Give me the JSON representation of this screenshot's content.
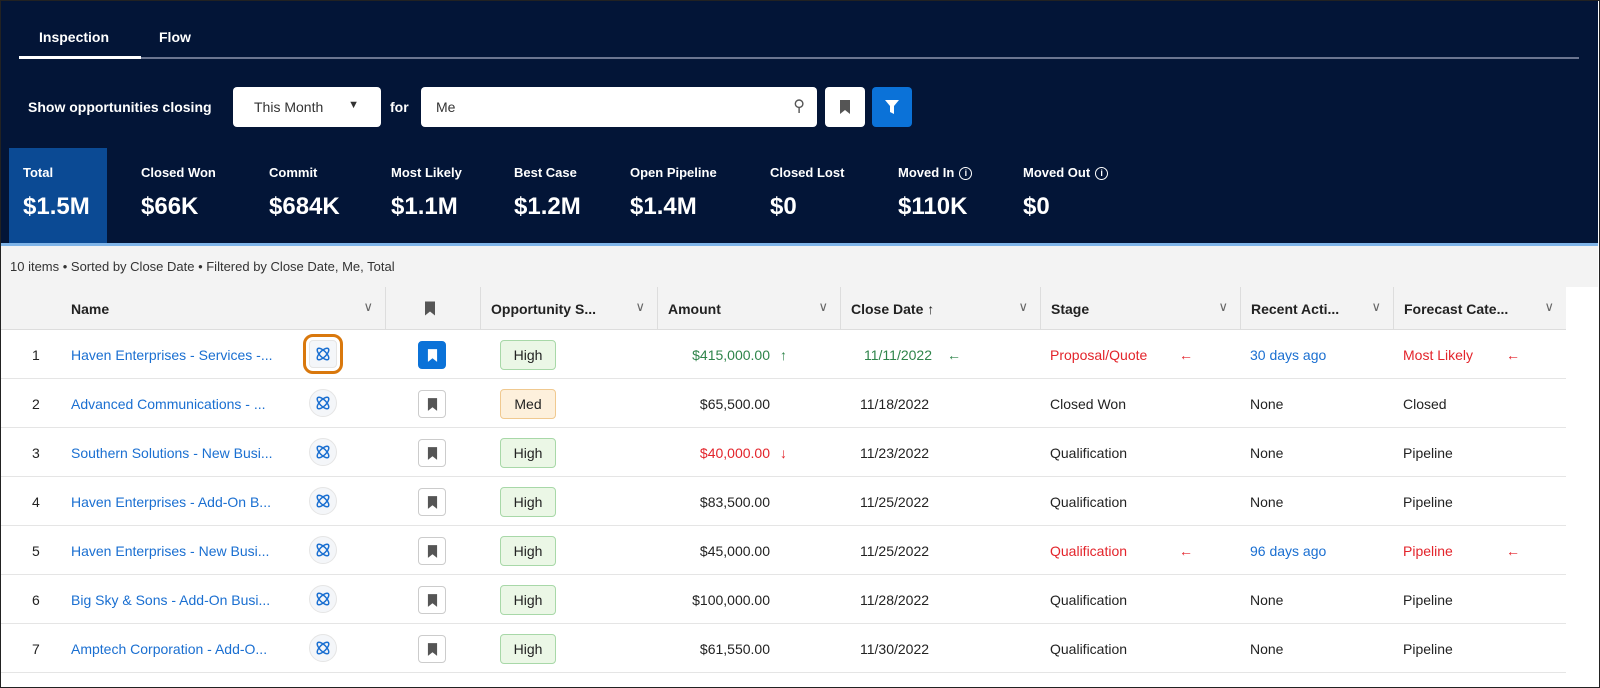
{
  "tabs": [
    {
      "label": "Inspection",
      "active": true
    },
    {
      "label": "Flow",
      "active": false
    }
  ],
  "filter": {
    "label": "Show opportunities closing",
    "period": "This Month",
    "for_label": "for",
    "owner": "Me",
    "search_icon": "search-icon",
    "bookmark_icon": "bookmark-icon",
    "filter_icon": "filter-icon"
  },
  "metrics": [
    {
      "label": "Total",
      "value": "$1.5M",
      "active": true
    },
    {
      "label": "Closed Won",
      "value": "$66K"
    },
    {
      "label": "Commit",
      "value": "$684K"
    },
    {
      "label": "Most Likely",
      "value": "$1.1M"
    },
    {
      "label": "Best Case",
      "value": "$1.2M"
    },
    {
      "label": "Open Pipeline",
      "value": "$1.4M"
    },
    {
      "label": "Closed Lost",
      "value": "$0"
    },
    {
      "label": "Moved In",
      "value": "$110K",
      "info": true
    },
    {
      "label": "Moved Out",
      "value": "$0",
      "info": true
    }
  ],
  "summary": "10 items • Sorted by Close Date • Filtered by Close Date, Me, Total",
  "columns": [
    "Name",
    "",
    "Opportunity S...",
    "Amount",
    "Close Date ↑",
    "Stage",
    "Recent Acti...",
    "Forecast Cate..."
  ],
  "colors": {
    "navy": "#031537",
    "accent": "#0b72d8",
    "up": "#2e844a",
    "down": "#e3242b"
  },
  "rows": [
    {
      "num": "1",
      "name": "Haven Enterprises - Services -...",
      "bookmarked": true,
      "score": "High",
      "amount": "$415,000.00",
      "amount_change": "up",
      "close": "11/11/2022",
      "close_change": "earlier",
      "stage": "Proposal/Quote",
      "stage_changed": true,
      "activity": "30 days ago",
      "activity_link": true,
      "forecast": "Most Likely",
      "forecast_changed": true,
      "highlighted": true
    },
    {
      "num": "2",
      "name": "Advanced Communications - ...",
      "score": "Med",
      "amount": "$65,500.00",
      "close": "11/18/2022",
      "stage": "Closed Won",
      "activity": "None",
      "forecast": "Closed"
    },
    {
      "num": "3",
      "name": "Southern Solutions - New Busi...",
      "score": "High",
      "amount": "$40,000.00",
      "amount_change": "down",
      "close": "11/23/2022",
      "stage": "Qualification",
      "activity": "None",
      "forecast": "Pipeline"
    },
    {
      "num": "4",
      "name": "Haven Enterprises - Add-On B...",
      "score": "High",
      "amount": "$83,500.00",
      "close": "11/25/2022",
      "stage": "Qualification",
      "activity": "None",
      "forecast": "Pipeline"
    },
    {
      "num": "5",
      "name": "Haven Enterprises - New Busi...",
      "score": "High",
      "amount": "$45,000.00",
      "close": "11/25/2022",
      "stage": "Qualification",
      "stage_changed": true,
      "activity": "96 days ago",
      "activity_link": true,
      "forecast": "Pipeline",
      "forecast_changed": true
    },
    {
      "num": "6",
      "name": "Big Sky & Sons - Add-On Busi...",
      "score": "High",
      "amount": "$100,000.00",
      "close": "11/28/2022",
      "stage": "Qualification",
      "activity": "None",
      "forecast": "Pipeline"
    },
    {
      "num": "7",
      "name": "Amptech Corporation - Add-O...",
      "score": "High",
      "amount": "$61,550.00",
      "close": "11/30/2022",
      "stage": "Qualification",
      "activity": "None",
      "forecast": "Pipeline"
    }
  ]
}
